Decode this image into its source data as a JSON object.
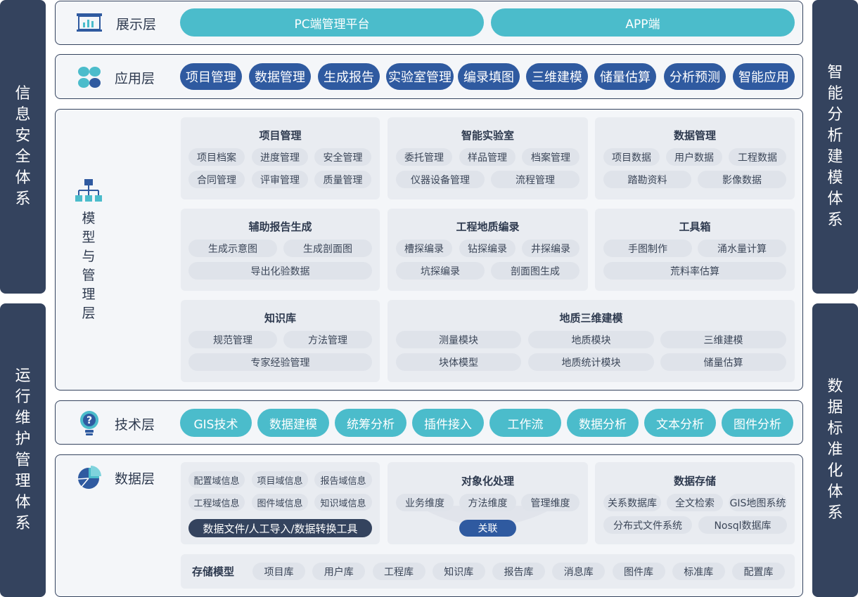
{
  "side": {
    "left_top": "信息安全体系",
    "left_bottom": "运行维护管理体系",
    "right_top": "智能分析建模体系",
    "right_bottom": "数据标准化体系"
  },
  "display": {
    "label": "展示层",
    "items": [
      "PC端管理平台",
      "APP端"
    ]
  },
  "application": {
    "label": "应用层",
    "items": [
      "项目管理",
      "数据管理",
      "生成报告",
      "实验室管理",
      "编录填图",
      "三维建模",
      "储量估算",
      "分析预测",
      "智能应用"
    ]
  },
  "model": {
    "label": "模型与管理层",
    "boxes": [
      {
        "title": "项目管理",
        "items": [
          "项目档案",
          "进度管理",
          "安全管理",
          "合同管理",
          "评审管理",
          "质量管理"
        ]
      },
      {
        "title": "智能实验室",
        "items": [
          "委托管理",
          "样品管理",
          "档案管理",
          "仪器设备管理",
          "流程管理"
        ]
      },
      {
        "title": "数据管理",
        "items": [
          "项目数据",
          "用户数据",
          "工程数据",
          "踏勘资料",
          "影像数据"
        ]
      },
      {
        "title": "辅助报告生成",
        "items": [
          "生成示意图",
          "生成剖面图",
          "导出化验数据"
        ]
      },
      {
        "title": "工程地质编录",
        "items": [
          "槽探编录",
          "钻探编录",
          "井探编录",
          "坑探编录",
          "剖面图生成"
        ]
      },
      {
        "title": "工具箱",
        "items": [
          "手图制作",
          "涌水量计算",
          "荒料率估算"
        ]
      },
      {
        "title": "知识库",
        "items": [
          "规范管理",
          "方法管理",
          "专家经验管理"
        ]
      },
      {
        "title": "地质三维建模",
        "items": [
          "测量模块",
          "地质模块",
          "三维建模",
          "块体模型",
          "地质统计模块",
          "储量估算"
        ]
      }
    ]
  },
  "tech": {
    "label": "技术层",
    "items": [
      "GIS技术",
      "数据建模",
      "统筹分析",
      "插件接入",
      "工作流",
      "数据分析",
      "文本分析",
      "图件分析"
    ]
  },
  "data_layer": {
    "label": "数据层",
    "domains": [
      "配置域信息",
      "项目域信息",
      "报告域信息",
      "工程域信息",
      "图件域信息",
      "知识域信息"
    ],
    "import_tool": "数据文件/人工导入/数据转换工具",
    "object": {
      "title": "对象化处理",
      "items": [
        "业务维度",
        "方法维度",
        "管理维度"
      ],
      "link": "关联"
    },
    "storage": {
      "title": "数据存储",
      "items": [
        "关系数据库",
        "全文检索",
        "GIS地图系统",
        "分布式文件系统",
        "Nosql数据库"
      ]
    },
    "model_storage": {
      "label": "存储模型",
      "items": [
        "项目库",
        "用户库",
        "工程库",
        "知识库",
        "报告库",
        "消息库",
        "图件库",
        "标准库",
        "配置库"
      ]
    }
  },
  "colors": {
    "navy": "#34435e",
    "teal": "#4bbccb",
    "blue": "#2f5aa0",
    "gray": "#dfe3ea"
  }
}
